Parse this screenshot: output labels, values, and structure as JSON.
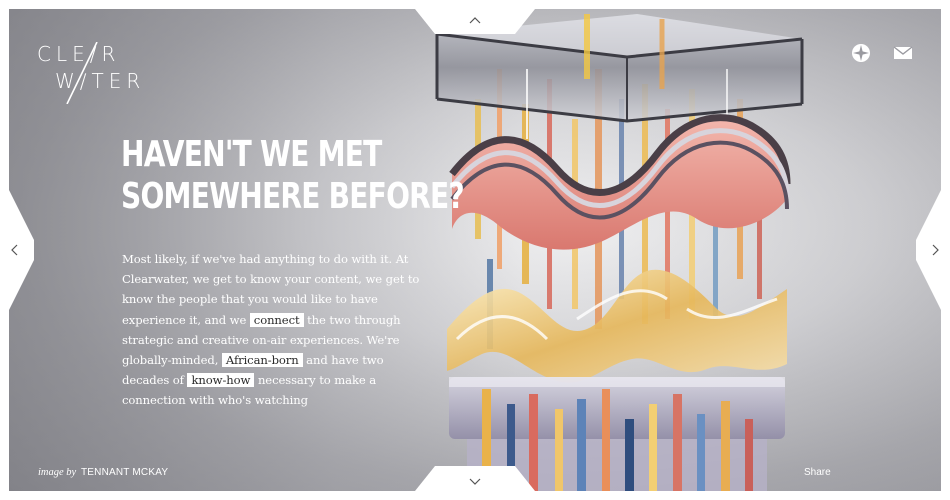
{
  "brand": {
    "logo_line1": "CLE∕R",
    "logo_line2": "W∕TER",
    "logo_name": "Clearwater"
  },
  "header_icons": [
    {
      "name": "compass-icon"
    },
    {
      "name": "mail-icon"
    }
  ],
  "hero": {
    "title_line1": "HAVEN'T WE MET",
    "title_line2": "SOMEWHERE BEFORE?",
    "body_part1": "Most likely, if we've had anything to do with it. At Clearwater, we get to know your content, we get to know the people that you would like to have experience it, and we ",
    "link_connect": "connect",
    "body_part2": " the two through strategic and creative on-air experiences. We're globally-minded, ",
    "link_african": "African-born",
    "body_part3": " and have two decades of ",
    "link_knowhow": "know-how",
    "body_part4": " necessary to make a connection with who's watching"
  },
  "footer": {
    "credit_prefix": "image by",
    "credit_author": "TENNANT MCKAY",
    "share_label": "Share"
  },
  "colors": {
    "text": "#ffffff",
    "highlight_bg": "#ffffff",
    "highlight_text": "#2a2a2a"
  }
}
